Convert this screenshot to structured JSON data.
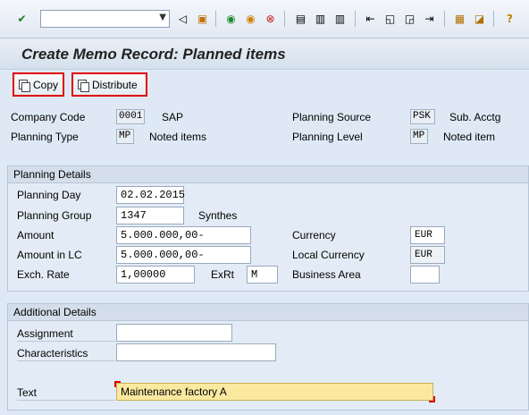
{
  "toolbar": {
    "command_field": "",
    "icons": [
      "enter-icon",
      "back-icon",
      "save-icon",
      "back-green-icon",
      "exit-icon",
      "cancel-icon",
      "print-icon",
      "find-icon",
      "find-next-icon",
      "first-page-icon",
      "prev-page-icon",
      "next-page-icon",
      "last-page-icon",
      "new-session-icon",
      "shortcut-icon",
      "help-icon"
    ]
  },
  "title": "Create Memo Record: Planned items",
  "buttons": {
    "copy": "Copy",
    "distribute": "Distribute"
  },
  "header": {
    "company_code_label": "Company Code",
    "company_code": "0001",
    "company_name": "SAP",
    "planning_type_label": "Planning Type",
    "planning_type": "MP",
    "planning_type_desc": "Noted items",
    "planning_source_label": "Planning Source",
    "planning_source": "PSK",
    "planning_source_desc": "Sub. Acctg",
    "planning_level_label": "Planning Level",
    "planning_level": "MP",
    "planning_level_desc": "Noted item"
  },
  "planning_details": {
    "title": "Planning Details",
    "planning_day_label": "Planning Day",
    "planning_day": "02.02.2015",
    "planning_group_label": "Planning Group",
    "planning_group": "1347",
    "planning_group_desc": "Synthes",
    "amount_label": "Amount",
    "amount": "5.000.000,00-",
    "amount_lc_label": "Amount in LC",
    "amount_lc": "5.000.000,00-",
    "exch_rate_label": "Exch. Rate",
    "exch_rate": "1,00000",
    "exrt_label": "ExRt",
    "exrt": "M",
    "currency_label": "Currency",
    "currency": "EUR",
    "local_currency_label": "Local Currency",
    "local_currency": "EUR",
    "business_area_label": "Business Area",
    "business_area": ""
  },
  "additional_details": {
    "title": "Additional Details",
    "assignment_label": "Assignment",
    "assignment": "",
    "characteristics_label": "Characteristics",
    "characteristics": "",
    "text_label": "Text",
    "text": "Maintenance factory A"
  }
}
